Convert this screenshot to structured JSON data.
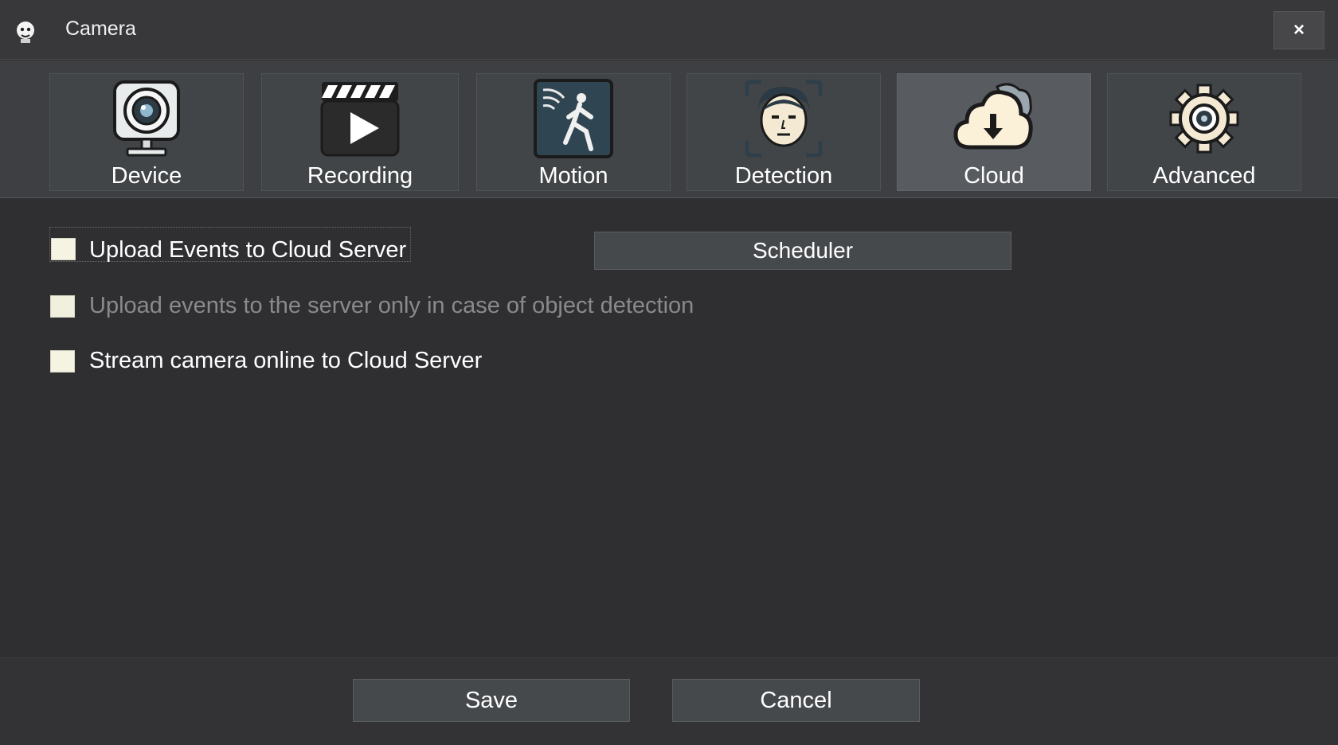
{
  "window": {
    "title": "Camera",
    "close_label": "×"
  },
  "tabs": [
    {
      "label": "Device",
      "icon": "webcam-icon",
      "active": false
    },
    {
      "label": "Recording",
      "icon": "clapperboard-icon",
      "active": false
    },
    {
      "label": "Motion",
      "icon": "motion-sensor-icon",
      "active": false
    },
    {
      "label": "Detection",
      "icon": "face-detection-icon",
      "active": false
    },
    {
      "label": "Cloud",
      "icon": "cloud-download-icon",
      "active": true
    },
    {
      "label": "Advanced",
      "icon": "gear-icon",
      "active": false
    }
  ],
  "cloud": {
    "upload_events_label": "Upload Events to Cloud Server",
    "upload_events_checked": false,
    "object_detection_label": "Upload events to the server only in case of object detection",
    "object_detection_checked": false,
    "object_detection_enabled": false,
    "stream_label": "Stream camera online to Cloud Server",
    "stream_checked": false,
    "scheduler_label": "Scheduler"
  },
  "footer": {
    "save_label": "Save",
    "cancel_label": "Cancel"
  },
  "colors": {
    "background": "#2f2f32",
    "tab_active": "#585c60",
    "checkbox_fill": "#f5f3e1",
    "disabled_text": "#8a8a8c"
  }
}
